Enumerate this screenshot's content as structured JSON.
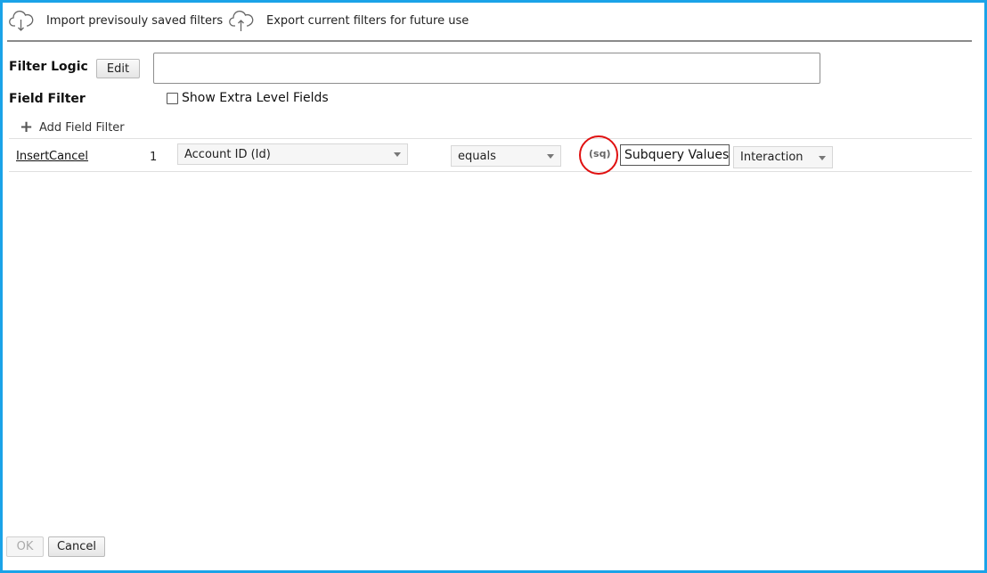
{
  "toolbar": {
    "import_label": "Import previsouly saved filters",
    "import_icon": "cloud-download-icon",
    "export_label": "Export current filters for future use",
    "export_icon": "cloud-upload-icon"
  },
  "filter_logic": {
    "label": "Filter Logic",
    "edit_label": "Edit",
    "value": ""
  },
  "field_filter": {
    "label": "Field Filter",
    "show_extra_label": "Show Extra Level Fields",
    "show_extra_checked": false,
    "add_label": "Add Field Filter",
    "add_icon": "plus-icon"
  },
  "rows": [
    {
      "insert_label": "Insert",
      "cancel_label": "Cancel",
      "index": "1",
      "field": "Account ID (Id)",
      "operator": "equals",
      "sq_label": "(sq)",
      "value": "Subquery Values",
      "object": "Interaction"
    }
  ],
  "footer": {
    "ok_label": "OK",
    "cancel_label": "Cancel"
  },
  "colors": {
    "frame_border": "#1aa3e8",
    "highlight_circle": "#e01010"
  }
}
